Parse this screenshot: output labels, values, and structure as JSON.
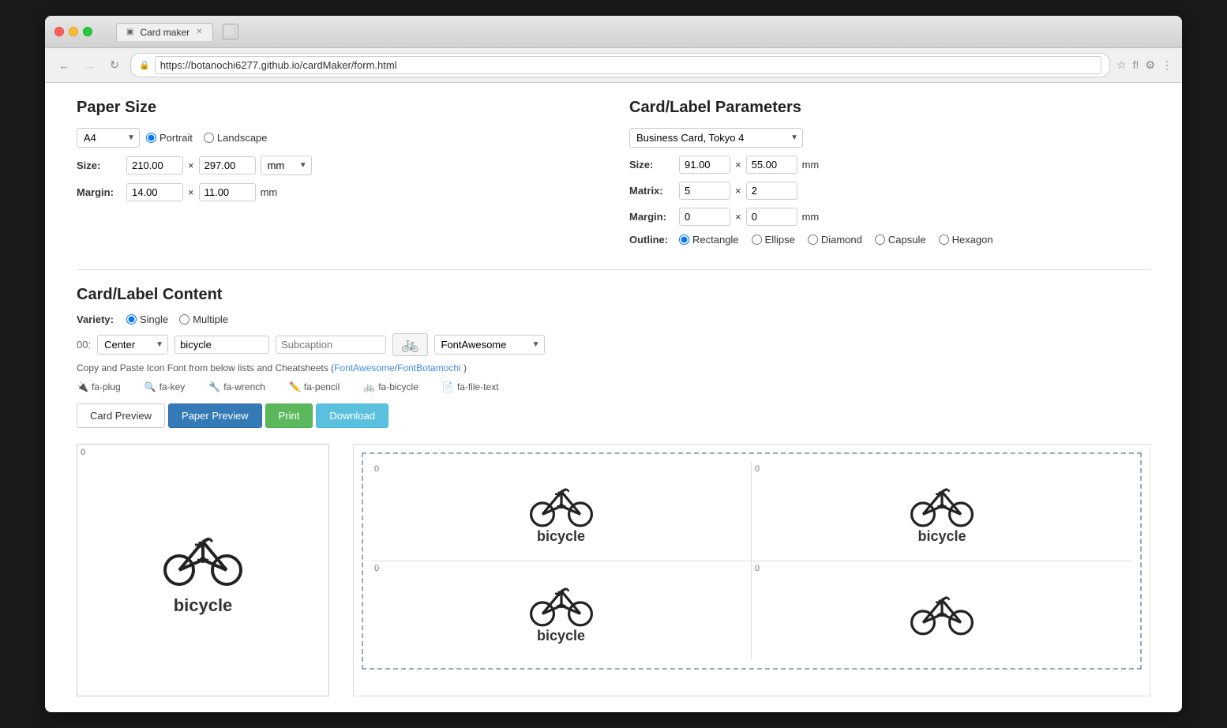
{
  "browser": {
    "title": "Card maker",
    "url": "https://botanochi6277.github.io/cardMaker/form.html",
    "tab_label": "Card maker"
  },
  "paper_size": {
    "heading": "Paper Size",
    "size_label": "Size:",
    "margin_label": "Margin:",
    "paper_select": "A4",
    "orientation_portrait": "Portrait",
    "orientation_landscape": "Landscape",
    "width": "210.00",
    "height": "297.00",
    "unit": "mm",
    "margin_width": "14.00",
    "margin_height": "11.00",
    "unit2": "mm"
  },
  "card_params": {
    "heading": "Card/Label Parameters",
    "preset_select": "Business Card, Tokyo 4",
    "size_label": "Size:",
    "size_w": "91.00",
    "size_h": "55.00",
    "size_unit": "mm",
    "matrix_label": "Matrix:",
    "matrix_cols": "5",
    "matrix_rows": "2",
    "margin_label": "Margin:",
    "margin_w": "0",
    "margin_h": "0",
    "margin_unit": "mm",
    "outline_label": "Outline:",
    "outline_options": [
      "Rectangle",
      "Ellipse",
      "Diamond",
      "Capsule",
      "Hexagon"
    ]
  },
  "card_content": {
    "heading": "Card/Label Content",
    "variety_label": "Variety:",
    "variety_single": "Single",
    "variety_multiple": "Multiple",
    "row_num": "00:",
    "align_select": "Center",
    "text_value": "bicycle",
    "subcaption_placeholder": "Subcaption",
    "icon_value": "&#x1f6b2;",
    "font_select": "FontAwesome",
    "hint_text": "Copy and Paste Icon Font from below lists and Cheatsheets (",
    "hint_link1": "FontAwesome",
    "hint_link2": "FontBotamochi",
    "hint_end": " )",
    "icons": [
      {
        "icon": "🔌",
        "label": "fa-plug"
      },
      {
        "icon": "🔑",
        "label": "fa-key"
      },
      {
        "icon": "🔧",
        "label": "fa-wrench"
      },
      {
        "icon": "✏️",
        "label": "fa-pencil"
      },
      {
        "icon": "🚲",
        "label": "fa-bicycle"
      },
      {
        "icon": "📄",
        "label": "fa-file-text"
      }
    ]
  },
  "buttons": {
    "card_preview": "Card Preview",
    "paper_preview": "Paper Preview",
    "print": "Print",
    "download": "Download"
  },
  "preview": {
    "card_corner": "0",
    "paper_corner1": "0",
    "paper_corner2": "0",
    "paper_corner3": "0",
    "paper_corner4": "0",
    "card_text": "bicycle",
    "paper_cards_text": "bicycle"
  }
}
